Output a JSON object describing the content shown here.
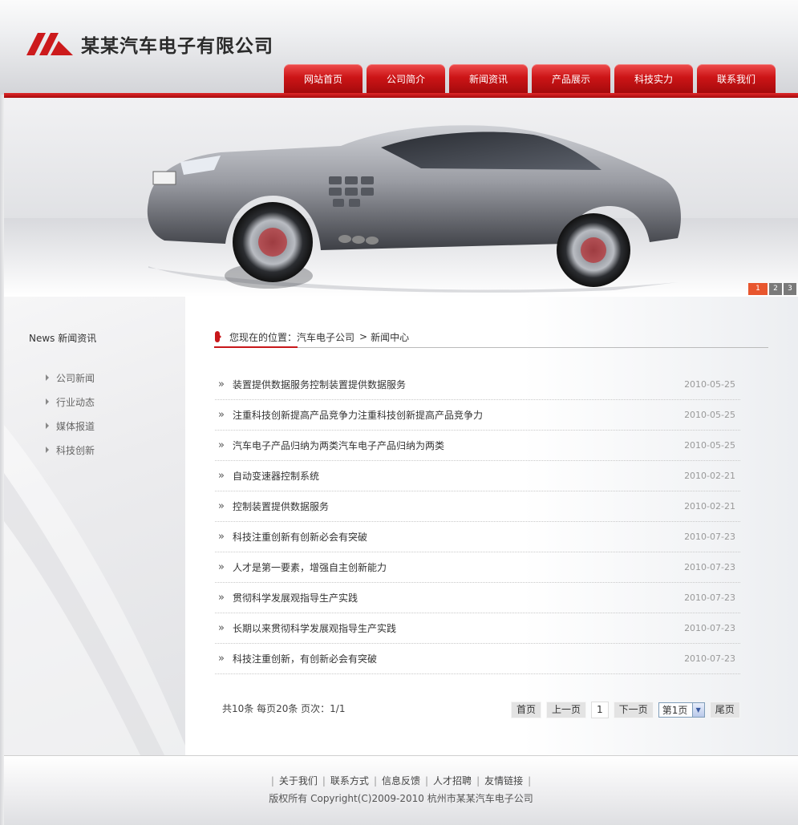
{
  "header": {
    "company_name": "某某汽车电子有限公司",
    "logo_color": "#cc1a1c"
  },
  "nav": {
    "items": [
      {
        "label": "网站首页"
      },
      {
        "label": "公司简介"
      },
      {
        "label": "新闻资讯"
      },
      {
        "label": "产品展示"
      },
      {
        "label": "科技实力"
      },
      {
        "label": "联系我们"
      }
    ]
  },
  "banner": {
    "image": "silver-sports-car",
    "slides": [
      "1",
      "2",
      "3"
    ],
    "active_slide": "1"
  },
  "sidebar": {
    "title_en": "News",
    "title_cn": "新闻资讯",
    "items": [
      {
        "label": "公司新闻"
      },
      {
        "label": "行业动态"
      },
      {
        "label": "媒体报道"
      },
      {
        "label": "科技创新"
      }
    ]
  },
  "breadcrumb": {
    "prefix": "您现在的位置：",
    "home": "汽车电子公司",
    "separator": ">",
    "current": "新闻中心"
  },
  "news": [
    {
      "title": "装置提供数据服务控制装置提供数据服务",
      "date": "2010-05-25"
    },
    {
      "title": "注重科技创新提高产品竞争力注重科技创新提高产品竞争力",
      "date": "2010-05-25"
    },
    {
      "title": "汽车电子产品归纳为两类汽车电子产品归纳为两类",
      "date": "2010-05-25"
    },
    {
      "title": "自动变速器控制系统",
      "date": "2010-02-21"
    },
    {
      "title": "控制装置提供数据服务",
      "date": "2010-02-21"
    },
    {
      "title": "科技注重创新有创新必会有突破",
      "date": "2010-07-23"
    },
    {
      "title": "人才是第一要素，增强自主创新能力",
      "date": "2010-07-23"
    },
    {
      "title": "贯彻科学发展观指导生产实践",
      "date": "2010-07-23"
    },
    {
      "title": "长期以来贯彻科学发展观指导生产实践",
      "date": "2010-07-23"
    },
    {
      "title": "科技注重创新，有创新必会有突破",
      "date": "2010-07-23"
    }
  ],
  "pagination": {
    "info": "共10条  每页20条  页次：1/1",
    "first": "首页",
    "prev": "上一页",
    "current_page": "1",
    "next": "下一页",
    "select_value": "第1页",
    "last": "尾页"
  },
  "footer": {
    "links": [
      {
        "label": "关于我们"
      },
      {
        "label": "联系方式"
      },
      {
        "label": "信息反馈"
      },
      {
        "label": "人才招聘"
      },
      {
        "label": "友情链接"
      }
    ],
    "copyright": "版权所有  Copyright(C)2009-2010 杭州市某某汽车电子公司"
  }
}
